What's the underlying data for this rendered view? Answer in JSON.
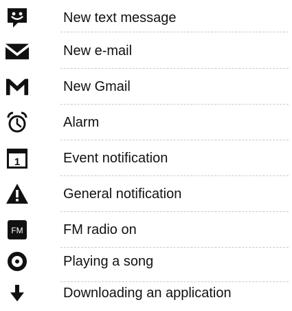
{
  "items": [
    {
      "icon": "speech-bubble-smiley-icon",
      "label": "New text message"
    },
    {
      "icon": "envelope-icon",
      "label": "New e-mail"
    },
    {
      "icon": "gmail-m-icon",
      "label": "New Gmail"
    },
    {
      "icon": "alarm-clock-icon",
      "label": "Alarm"
    },
    {
      "icon": "calendar-icon",
      "label": "Event notification"
    },
    {
      "icon": "warning-triangle-icon",
      "label": "General notification"
    },
    {
      "icon": "fm-radio-icon",
      "label": "FM radio on"
    },
    {
      "icon": "record-disc-icon",
      "label": "Playing a song"
    },
    {
      "icon": "download-arrow-icon",
      "label": "Downloading an application"
    }
  ],
  "icon_texts": {
    "calendar_day": "1",
    "fm": "FM"
  },
  "colors": {
    "icon": "#111111",
    "separator": "#c9c9c9",
    "text": "#111111"
  }
}
